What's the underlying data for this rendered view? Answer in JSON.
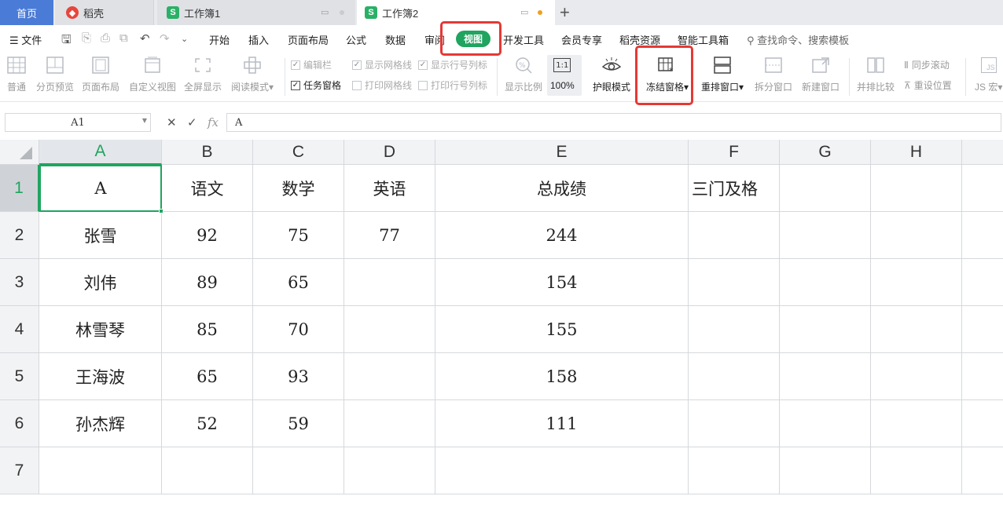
{
  "tabs": {
    "home": "首页",
    "docer": "稻壳",
    "workbook1": "工作簿1",
    "workbook2": "工作簿2"
  },
  "menu": {
    "file": "文件",
    "items": [
      "开始",
      "插入",
      "页面布局",
      "公式",
      "数据",
      "审阅"
    ],
    "active": "视图",
    "items_after": [
      "开发工具",
      "会员专享",
      "稻壳资源",
      "智能工具箱"
    ],
    "search": "查找命令、搜索模板"
  },
  "ribbon": {
    "normal": "普通",
    "page_break_preview": "分页预览",
    "page_layout": "页面布局",
    "custom_view": "自定义视图",
    "full_screen": "全屏显示",
    "reading_mode": "阅读模式",
    "formula_bar": "编辑栏",
    "task_pane": "任务窗格",
    "show_gridlines": "显示网格线",
    "print_gridlines": "打印网格线",
    "show_headings": "显示行号列标",
    "print_headings": "打印行号列标",
    "zoom": "显示比例",
    "zoom_100": "100%",
    "zoom_100_icon": "1:1",
    "eye_protection": "护眼模式",
    "freeze_panes": "冻结窗格",
    "arrange_all": "重排窗口",
    "split_window": "拆分窗口",
    "new_window": "新建窗口",
    "side_by_side": "并排比较",
    "sync_scroll": "同步滚动",
    "reset_position": "重设位置",
    "js_macro": "JS 宏",
    "js_icon": "JS"
  },
  "formula_bar": {
    "name_box": "A1",
    "fx": "fx",
    "content": "A"
  },
  "sheet": {
    "columns": [
      "A",
      "B",
      "C",
      "D",
      "E",
      "F",
      "G",
      "H"
    ],
    "row_numbers": [
      "1",
      "2",
      "3",
      "4",
      "5",
      "6",
      "7"
    ],
    "rows": [
      [
        "A",
        "语文",
        "数学",
        "英语",
        "总成绩",
        "三门及格",
        "",
        ""
      ],
      [
        "张雪",
        "92",
        "75",
        "77",
        "244",
        "",
        "",
        ""
      ],
      [
        "刘伟",
        "89",
        "65",
        "",
        "154",
        "",
        "",
        ""
      ],
      [
        "林雪琴",
        "85",
        "70",
        "",
        "155",
        "",
        "",
        ""
      ],
      [
        "王海波",
        "65",
        "93",
        "",
        "158",
        "",
        "",
        ""
      ],
      [
        "孙杰辉",
        "52",
        "59",
        "",
        "111",
        "",
        "",
        ""
      ],
      [
        "",
        "",
        "",
        "",
        "",
        "",
        "",
        ""
      ]
    ],
    "active_cell": "A1"
  },
  "colors": {
    "accent_green": "#20a45f",
    "highlight_red": "#e53935",
    "home_tab_blue": "#4a7bd6",
    "unsaved_dot": "#f0a020"
  }
}
